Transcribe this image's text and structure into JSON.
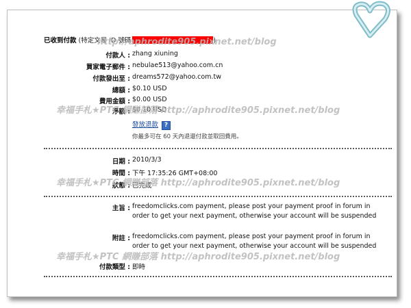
{
  "header": {
    "title": "已收到付款",
    "transaction_prefix": "(特定文易 ID 號碼",
    "transaction_suffix": ")"
  },
  "payment": [
    {
      "label": "付款人 :",
      "value": "zhang xiuning"
    },
    {
      "label": "買家電子郵件 :",
      "value": "nebulae513@yahoo.com.cn"
    },
    {
      "label": "付款發出至 :",
      "value": "dreams572@yahoo.com.tw"
    },
    {
      "label": "總額 :",
      "value": "$0.10 USD"
    },
    {
      "label": "費用金額 :",
      "value": "$0.00 USD"
    },
    {
      "label": "淨額 :",
      "value": "$0.10 USD"
    }
  ],
  "refund": {
    "link_label": "發放退款",
    "help_icon": "?",
    "note": "你最多可在 60 天內退還付款並取回費用。"
  },
  "status_section": [
    {
      "label": "日期 :",
      "value": "2010/3/3"
    },
    {
      "label": "時間 :",
      "value": "下午 17:35:26 GMT+08:00"
    },
    {
      "label": "狀態 :",
      "value": "已完成"
    }
  ],
  "message_section": {
    "subject_label": "主旨 :",
    "subject_value": "freedomclicks.com payment, please post your payment proof in forum in order to get your next payment, otherwise your account will be suspended",
    "note_label": "附註 :",
    "note_value": "freedomclicks.com payment, please post your payment proof in forum in order to get your next payment, otherwise your account will be suspended",
    "type_label": "付款類型 :",
    "type_value": "即時"
  },
  "watermark": {
    "text": "幸福手札★PTC 網賺部落 http://aphrodite905.pixnet.net/blog",
    "url_text": "http://aphrodite905.pixnet.net/blog"
  },
  "colors": {
    "redaction": "#ff0000",
    "link": "#1a4a9e",
    "heart": "#7fbcc8"
  }
}
